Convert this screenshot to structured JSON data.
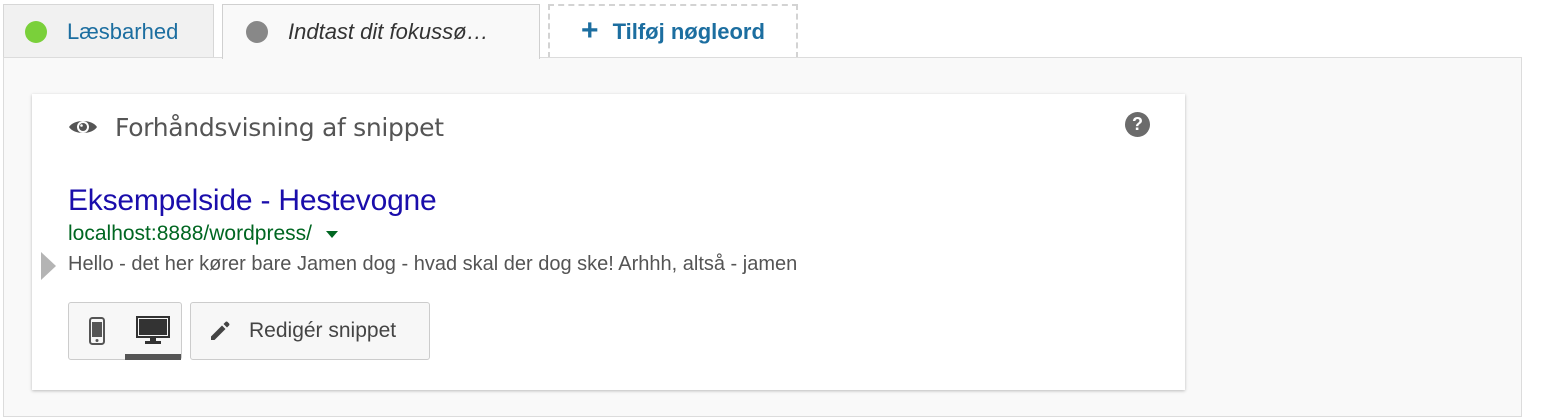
{
  "tabs": {
    "readability": {
      "label": "Læsbarhed",
      "status_color": "#7ad03a"
    },
    "focus_keyword": {
      "label": "Indtast dit fokussø…",
      "status_color": "#888888"
    },
    "add_keyword": {
      "label": "Tilføj nøgleord",
      "icon": "plus-icon"
    }
  },
  "snippet_preview": {
    "header": "Forhåndsvisning af snippet",
    "header_icon": "eye-icon",
    "help_icon": "question-icon",
    "help_glyph": "?",
    "title": "Eksempelside - Hestevogne",
    "url": "localhost:8888/wordpress/",
    "description": "Hello - det her kører bare Jamen dog - hvad skal der dog ske! Arhhh, altså - jamen",
    "modes": [
      {
        "name": "mobile",
        "icon": "mobile-icon",
        "active": false
      },
      {
        "name": "desktop",
        "icon": "desktop-icon",
        "active": true
      }
    ],
    "edit_button": {
      "label": "Redigér snippet",
      "icon": "pencil-icon"
    }
  },
  "colors": {
    "link_blue": "#1c6ea0",
    "serp_title": "#1a0dab",
    "serp_url": "#006621",
    "serp_desc": "#545454"
  }
}
